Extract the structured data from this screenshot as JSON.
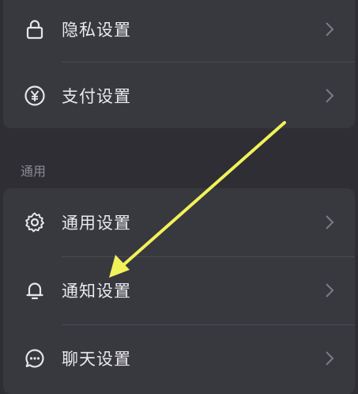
{
  "privacy_section": {
    "items": [
      {
        "label": "隐私设置",
        "icon": "lock-icon"
      },
      {
        "label": "支付设置",
        "icon": "yen-circle-icon"
      }
    ]
  },
  "general_section": {
    "title": "通用",
    "items": [
      {
        "label": "通用设置",
        "icon": "gear-icon"
      },
      {
        "label": "通知设置",
        "icon": "bell-icon"
      },
      {
        "label": "聊天设置",
        "icon": "chat-bubble-icon"
      }
    ]
  },
  "colors": {
    "background": "#2e2e34",
    "card": "#38383f",
    "text": "#e9e9ee",
    "section_title": "#8b8b93",
    "chevron": "#7c7c84",
    "arrow_annotation": "#f2f25a"
  }
}
